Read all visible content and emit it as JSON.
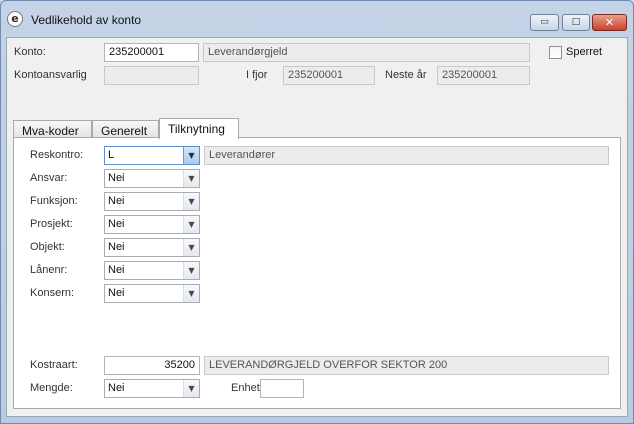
{
  "window": {
    "title": "Vedlikehold av konto",
    "app_icon_glyph": "e",
    "controls": {
      "minimize": "▭",
      "maximize": "□",
      "close": "✕"
    }
  },
  "header": {
    "konto_label": "Konto:",
    "konto_value": "235200001",
    "konto_name": "Leverandørgjeld",
    "sperret_label": "Sperret",
    "sperret_checked": false,
    "kontoansvarlig_label": "Kontoansvarlig",
    "kontoansvarlig_value": "",
    "ifjor_label": "I fjor",
    "ifjor_value": "235200001",
    "nestear_label": "Neste år",
    "nestear_value": "235200001"
  },
  "tabs": [
    {
      "label": "Mva-koder",
      "active": false
    },
    {
      "label": "Generelt",
      "active": false
    },
    {
      "label": "Tilknytning",
      "active": true
    }
  ],
  "tilknytning": {
    "reskontro": {
      "label": "Reskontro:",
      "value": "L",
      "description": "Leverandører"
    },
    "rows": [
      {
        "label": "Ansvar:",
        "value": "Nei"
      },
      {
        "label": "Funksjon:",
        "value": "Nei"
      },
      {
        "label": "Prosjekt:",
        "value": "Nei"
      },
      {
        "label": "Objekt:",
        "value": "Nei"
      },
      {
        "label": "Lånenr:",
        "value": "Nei"
      },
      {
        "label": "Konsern:",
        "value": "Nei"
      }
    ],
    "kostraart": {
      "label": "Kostraart:",
      "value": "35200",
      "description": "LEVERANDØRGJELD OVERFOR SEKTOR 200"
    },
    "mengde": {
      "label": "Mengde:",
      "value": "Nei"
    },
    "enhet": {
      "label": "Enhet:",
      "value": ""
    }
  },
  "icons": {
    "dropdown": "▼"
  }
}
